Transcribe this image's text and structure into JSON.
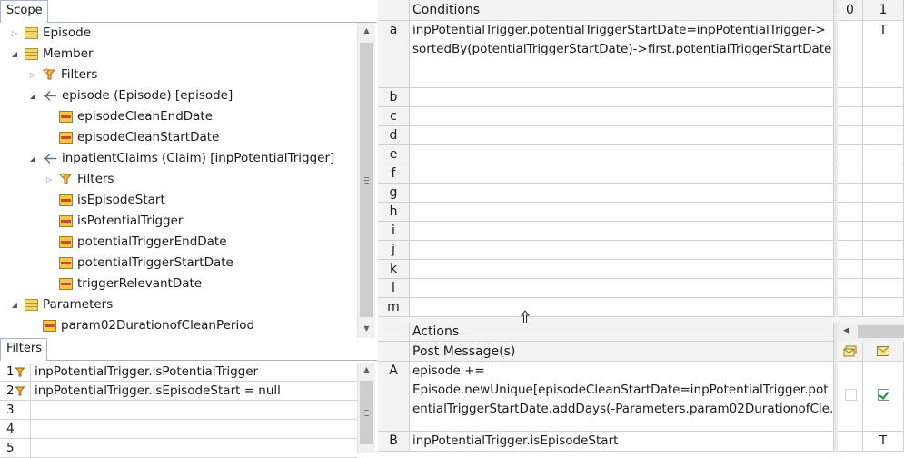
{
  "scope": {
    "tab_label": "Scope",
    "tree": [
      {
        "label": "Episode",
        "icon": "entity",
        "twist": "collapsed",
        "depth": 0
      },
      {
        "label": "Member",
        "icon": "entity",
        "twist": "expanded",
        "depth": 0
      },
      {
        "label": "Filters",
        "icon": "filter",
        "twist": "collapsed",
        "depth": 1
      },
      {
        "label": "episode (Episode) [episode]",
        "icon": "association",
        "twist": "expanded",
        "depth": 1
      },
      {
        "label": "episodeCleanEndDate",
        "icon": "attribute",
        "twist": "none",
        "depth": 2
      },
      {
        "label": "episodeCleanStartDate",
        "icon": "attribute",
        "twist": "none",
        "depth": 2
      },
      {
        "label": "inpatientClaims (Claim) [inpPotentialTrigger]",
        "icon": "association",
        "twist": "expanded",
        "depth": 1
      },
      {
        "label": "Filters",
        "icon": "filter",
        "twist": "collapsed",
        "depth": 2
      },
      {
        "label": "isEpisodeStart",
        "icon": "attribute",
        "twist": "none",
        "depth": 2
      },
      {
        "label": "isPotentialTrigger",
        "icon": "attribute",
        "twist": "none",
        "depth": 2
      },
      {
        "label": "potentialTriggerEndDate",
        "icon": "attribute",
        "twist": "none",
        "depth": 2
      },
      {
        "label": "potentialTriggerStartDate",
        "icon": "attribute",
        "twist": "none",
        "depth": 2
      },
      {
        "label": "triggerRelevantDate",
        "icon": "attribute",
        "twist": "none",
        "depth": 2
      },
      {
        "label": "Parameters",
        "icon": "entity",
        "twist": "expanded",
        "depth": 0
      },
      {
        "label": "param02DurationofCleanPeriod",
        "icon": "attribute",
        "twist": "none",
        "depth": 1
      }
    ]
  },
  "filters": {
    "tab_label": "Filters",
    "rows": [
      {
        "num": "1",
        "text": "inpPotentialTrigger.isPotentialTrigger",
        "has_icon": true
      },
      {
        "num": "2",
        "text": "inpPotentialTrigger.isEpisodeStart = null",
        "has_icon": true
      },
      {
        "num": "3",
        "text": "",
        "has_icon": false
      },
      {
        "num": "4",
        "text": "",
        "has_icon": false
      },
      {
        "num": "5",
        "text": "",
        "has_icon": false
      }
    ]
  },
  "conditions": {
    "header": "Conditions",
    "columns": [
      "0",
      "1"
    ],
    "rows": [
      {
        "label": "a",
        "lines": [
          "inpPotentialTrigger.potentialTriggerStartDate=inpPotentialTrigger->",
          "sortedBy(potentialTriggerStartDate)->first.potentialTriggerStartDate"
        ],
        "values": [
          "",
          "T"
        ]
      },
      {
        "label": "b",
        "lines": [
          ""
        ],
        "values": [
          "",
          ""
        ]
      },
      {
        "label": "c",
        "lines": [
          ""
        ],
        "values": [
          "",
          ""
        ]
      },
      {
        "label": "d",
        "lines": [
          ""
        ],
        "values": [
          "",
          ""
        ]
      },
      {
        "label": "e",
        "lines": [
          ""
        ],
        "values": [
          "",
          ""
        ]
      },
      {
        "label": "f",
        "lines": [
          ""
        ],
        "values": [
          "",
          ""
        ]
      },
      {
        "label": "g",
        "lines": [
          ""
        ],
        "values": [
          "",
          ""
        ]
      },
      {
        "label": "h",
        "lines": [
          ""
        ],
        "values": [
          "",
          ""
        ]
      },
      {
        "label": "i",
        "lines": [
          ""
        ],
        "values": [
          "",
          ""
        ]
      },
      {
        "label": "j",
        "lines": [
          ""
        ],
        "values": [
          "",
          ""
        ]
      },
      {
        "label": "k",
        "lines": [
          ""
        ],
        "values": [
          "",
          ""
        ]
      },
      {
        "label": "l",
        "lines": [
          ""
        ],
        "values": [
          "",
          ""
        ]
      },
      {
        "label": "m",
        "lines": [
          ""
        ],
        "values": [
          "",
          ""
        ]
      }
    ]
  },
  "actions": {
    "header": "Actions",
    "post_message_label": "Post Message(s)",
    "rows": [
      {
        "label": "A",
        "lines": [
          "episode +=",
          "Episode.newUnique[episodeCleanStartDate=inpPotentialTrigger.pot",
          "entialTriggerStartDate.addDays(-Parameters.param02DurationofCle..."
        ],
        "values": [
          "",
          ""
        ],
        "checks": [
          false,
          true
        ]
      },
      {
        "label": "B",
        "lines": [
          "inpPotentialTrigger.isEpisodeStart"
        ],
        "values": [
          "",
          "T"
        ],
        "checks": [
          false,
          false
        ]
      }
    ]
  },
  "icons": {
    "entity": "entity-icon",
    "attribute": "attribute-icon",
    "association": "association-icon",
    "filter": "filter-icon",
    "post_message_col0": "envelope-stack-icon",
    "post_message_col1": "envelope-icon",
    "resize": "resize-vertical-icon"
  },
  "colors": {
    "header_bg": "#f3f3f3",
    "grid": "#d0d0d0",
    "check_green": "#1d8a2a",
    "entity_yellow": "#f3d56b"
  }
}
